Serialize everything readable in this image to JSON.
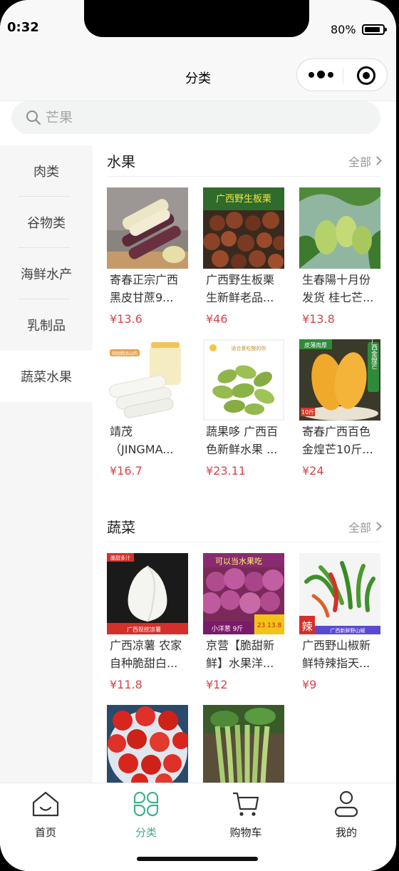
{
  "status": {
    "time": "0:32",
    "battery": "80%"
  },
  "nav": {
    "title": "分类"
  },
  "search": {
    "placeholder": "芒果"
  },
  "sidebar": {
    "items": [
      "肉类",
      "谷物类",
      "海鲜水产",
      "乳制品",
      "蔬菜水果"
    ],
    "active_index": 4
  },
  "sections": [
    {
      "title": "水果",
      "more": "全部",
      "products": [
        {
          "name": "寄春正宗广西黑皮甘蔗9...",
          "price": "¥13.6",
          "image": "sugarcane"
        },
        {
          "name": "广西野生板栗生新鲜老品...",
          "price": "¥46",
          "image": "chestnut"
        },
        {
          "name": "生春陽十月份发货 桂七芒...",
          "price": "¥13.8",
          "image": "mango-tree"
        },
        {
          "name": "靖茂（JINGMA...",
          "price": "¥16.7",
          "image": "yam"
        },
        {
          "name": "蔬果哆 广西百色新鲜水果 ...",
          "price": "¥23.11",
          "image": "green-mango"
        },
        {
          "name": "寄春广西百色金煌芒10斤...",
          "price": "¥24",
          "image": "golden-mango"
        }
      ]
    },
    {
      "title": "蔬菜",
      "more": "全部",
      "products": [
        {
          "name": "广西凉薯 农家自种脆甜白...",
          "price": "¥11.8",
          "image": "jicama"
        },
        {
          "name": "京营【脆甜新鲜】水果洋...",
          "price": "¥12",
          "image": "onion"
        },
        {
          "name": "广西野山椒新鲜特辣指天...",
          "price": "¥9",
          "image": "chili"
        },
        {
          "name": "",
          "price": "",
          "image": "tomato"
        },
        {
          "name": "",
          "price": "",
          "image": "beans"
        }
      ]
    }
  ],
  "image_text": {
    "chestnut": "广西野生板栗",
    "yam_tag": "田园精品山药",
    "green_mango_tag": "适合爱吃酸的你",
    "golden_mango_a": "皮薄肉厚",
    "golden_mango_b": "广西金煌芒",
    "golden_mango_c": "10斤",
    "jicama_top": "脆甜多汁",
    "jicama_bottom": "广西现挖凉薯",
    "onion_top": "可以当水果吃",
    "onion_bottom": "小洋葱 9斤",
    "onion_badge": "23 13.8",
    "chili_a": "辣",
    "chili_b": "广西新鲜野山椒"
  },
  "tabbar": {
    "items": [
      {
        "label": "首页",
        "icon": "home-icon"
      },
      {
        "label": "分类",
        "icon": "category-icon"
      },
      {
        "label": "购物车",
        "icon": "cart-icon"
      },
      {
        "label": "我的",
        "icon": "profile-icon"
      }
    ],
    "active_index": 1,
    "active_color": "#3fb08f"
  },
  "colors": {
    "price": "#d9434b",
    "accent": "#3fb08f"
  }
}
